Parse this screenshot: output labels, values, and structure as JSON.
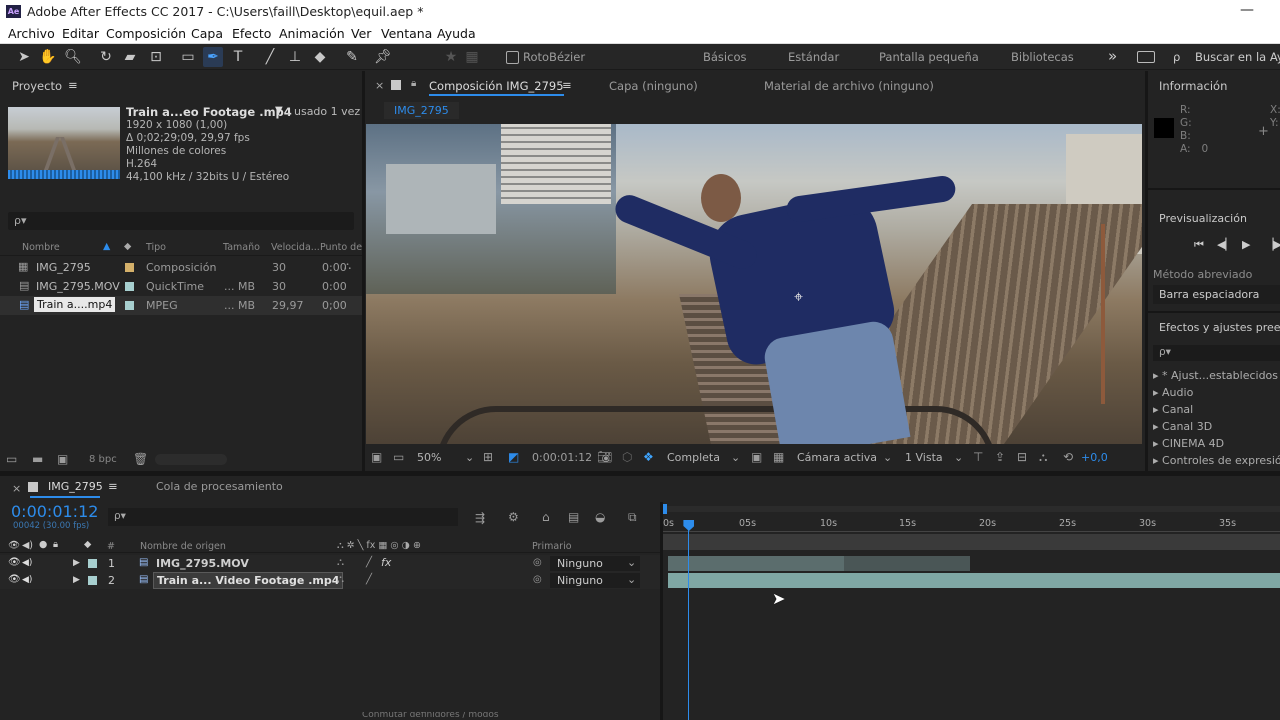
{
  "titlebar": {
    "title": "Adobe After Effects CC 2017 - C:\\Users\\faill\\Desktop\\equil.aep *",
    "app_icon": "Ae"
  },
  "menu": [
    "Archivo",
    "Editar",
    "Composición",
    "Capa",
    "Efecto",
    "Animación",
    "Ver",
    "Ventana",
    "Ayuda"
  ],
  "toolbar": {
    "rotobezier": "RotoBézier",
    "workspaces": [
      "Básicos",
      "Estándar",
      "Pantalla pequeña",
      "Bibliotecas"
    ],
    "more": "»",
    "search": "Buscar en la Ayu"
  },
  "project": {
    "title": "Proyecto",
    "menu_icon": "≡",
    "footage_name": "Train a...eo Footage .mp4",
    "footage_used": ", usado 1 vez",
    "footage_info": [
      "1920 x 1080 (1,00)",
      "Δ 0;02;29;09, 29,97 fps",
      "Millones de colores",
      "H.264",
      "44,100 kHz / 32bits U / Estéreo"
    ],
    "search_icon": "ρ▾",
    "columns": [
      "Nombre",
      "Tipo",
      "Tamaño",
      "Velocida...",
      "Punto de"
    ],
    "items": [
      {
        "name": "IMG_2795",
        "type": "Composición",
        "size": "",
        "rate": "30",
        "point": "0:00",
        "color": "#d4b06a"
      },
      {
        "name": "IMG_2795.MOV",
        "type": "QuickTime",
        "size": "... MB",
        "rate": "30",
        "point": "0:00",
        "color": "#a7cfcf"
      },
      {
        "name": "Train a....mp4",
        "type": "MPEG",
        "size": "... MB",
        "rate": "29,97",
        "point": "0;00",
        "color": "#a7cfcf"
      }
    ],
    "bpc": "8 bpc"
  },
  "composition": {
    "tab": "Composición IMG_2795",
    "tab_layer": "Capa (ninguno)",
    "tab_footage": "Material de archivo (ninguno)",
    "comp_tag": "IMG_2795",
    "zoom": "50%",
    "timecode": "0:00:01:12",
    "resolution": "Completa",
    "camera": "Cámara activa",
    "views": "1 Vista",
    "exposure": "+0,0"
  },
  "info": {
    "title": "Información",
    "channels": [
      "R:",
      "G:",
      "B:",
      "A:"
    ],
    "alpha_value": "0",
    "coords": [
      "X:",
      "Y:"
    ]
  },
  "preview": {
    "title": "Previsualización",
    "shortcut_label": "Método abreviado",
    "shortcut_value": "Barra espaciadora"
  },
  "effects": {
    "title": "Efectos y ajustes preest",
    "items": [
      "* Ajust...establecidos d",
      "Audio",
      "Canal",
      "Canal 3D",
      "CINEMA 4D",
      "Controles de expresión"
    ]
  },
  "timeline": {
    "tab": "IMG_2795",
    "tab_render": "Cola de procesamiento",
    "timecode": "0:00:01:12",
    "frames": "00042 (30.00 fps)",
    "col_name": "Nombre de origen",
    "col_parent": "Primario",
    "layers": [
      {
        "num": "1",
        "name": "IMG_2795.MOV",
        "parent": "Ninguno",
        "fx": "fx"
      },
      {
        "num": "2",
        "name": "Train a... Video Footage .mp4",
        "parent": "Ninguno",
        "fx": ""
      }
    ],
    "ruler": [
      "0s",
      "05s",
      "10s",
      "15s",
      "20s",
      "25s",
      "30s",
      "35s"
    ],
    "playhead_seconds": 1.4,
    "footer": "Conmutar definidores / modos"
  },
  "colors": {
    "accent": "#2d8ceb",
    "timecode": "#2d8ceb",
    "label_teal": "#a7cfcf",
    "label_tan": "#d4b06a"
  }
}
